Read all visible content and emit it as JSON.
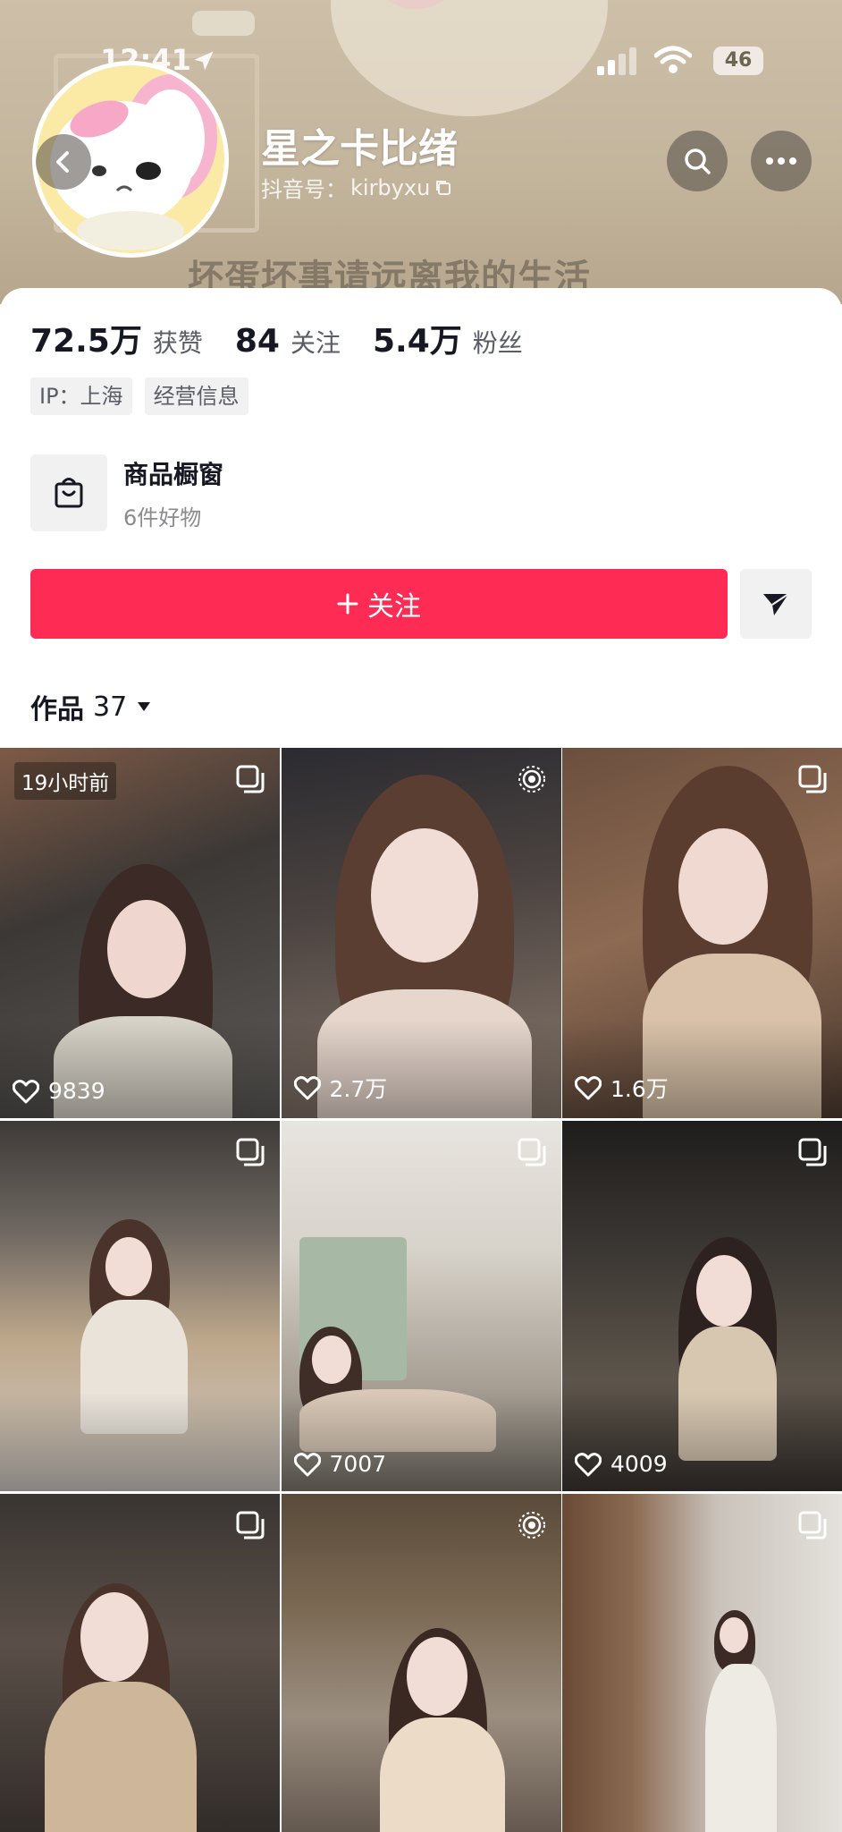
{
  "status_bar": {
    "time": "12:41",
    "battery": "46"
  },
  "banner": {
    "slogan": "坏蛋坏事请远离我的生活"
  },
  "profile": {
    "name": "星之卡比绪",
    "id_label": "抖音号：",
    "id_value": "kirbyxu"
  },
  "stats": [
    {
      "value": "72.5万",
      "label": "获赞"
    },
    {
      "value": "84",
      "label": "关注"
    },
    {
      "value": "5.4万",
      "label": "粉丝"
    }
  ],
  "tags": [
    "IP：上海",
    "经营信息"
  ],
  "shop": {
    "title": "商品橱窗",
    "subtitle": "6件好物",
    "icon": "shopping-bag-icon"
  },
  "actions": {
    "follow_label": "关注",
    "follow_icon": "plus-icon",
    "share_icon": "paper-plane-icon"
  },
  "works_tab": {
    "label": "作品",
    "count": "37"
  },
  "colors": {
    "accent": "#fe2c55",
    "text": "#161823",
    "secondary": "#5b5d66"
  },
  "posts": [
    {
      "likes": "9839",
      "type": "image-set",
      "badge": "19小时前"
    },
    {
      "likes": "2.7万",
      "type": "live-photo"
    },
    {
      "likes": "1.6万",
      "type": "image-set"
    },
    {
      "likes": "",
      "type": "image-set"
    },
    {
      "likes": "7007",
      "type": "image-set"
    },
    {
      "likes": "4009",
      "type": "image-set"
    },
    {
      "likes": "",
      "type": "image-set"
    },
    {
      "likes": "",
      "type": "live-photo"
    },
    {
      "likes": "",
      "type": "image-set"
    }
  ]
}
